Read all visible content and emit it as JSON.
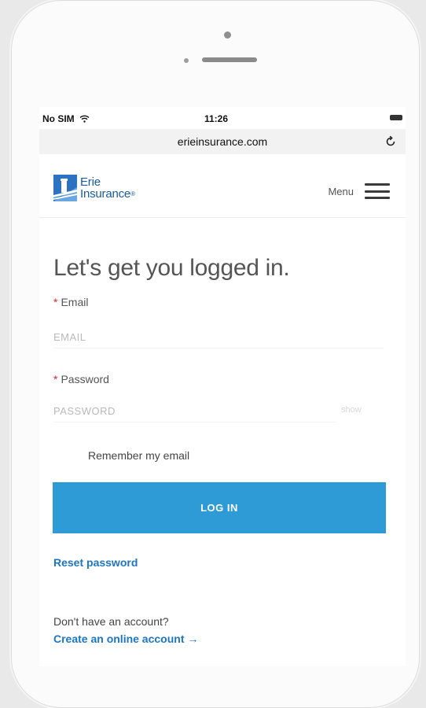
{
  "status_bar": {
    "carrier": "No SIM",
    "time": "11:26"
  },
  "browser": {
    "url": "erieinsurance.com"
  },
  "header": {
    "logo_line1": "Erie",
    "logo_line2": "Insurance",
    "logo_reg": "®",
    "menu_label": "Menu"
  },
  "login": {
    "title": "Let's get you logged in.",
    "required_mark": "*",
    "email_label": "Email",
    "email_placeholder": "EMAIL",
    "password_label": "Password",
    "password_placeholder": "PASSWORD",
    "show_label": "show",
    "remember_label": "Remember my email",
    "login_button": "LOG IN",
    "reset_link": "Reset password",
    "no_account_text": "Don't have an account?",
    "create_link": "Create an online account",
    "create_arrow": "→"
  },
  "colors": {
    "brand_blue": "#1b5aa0",
    "button_blue": "#2f9bd6",
    "link_blue": "#1d76c2",
    "required_red": "#dd2233"
  }
}
